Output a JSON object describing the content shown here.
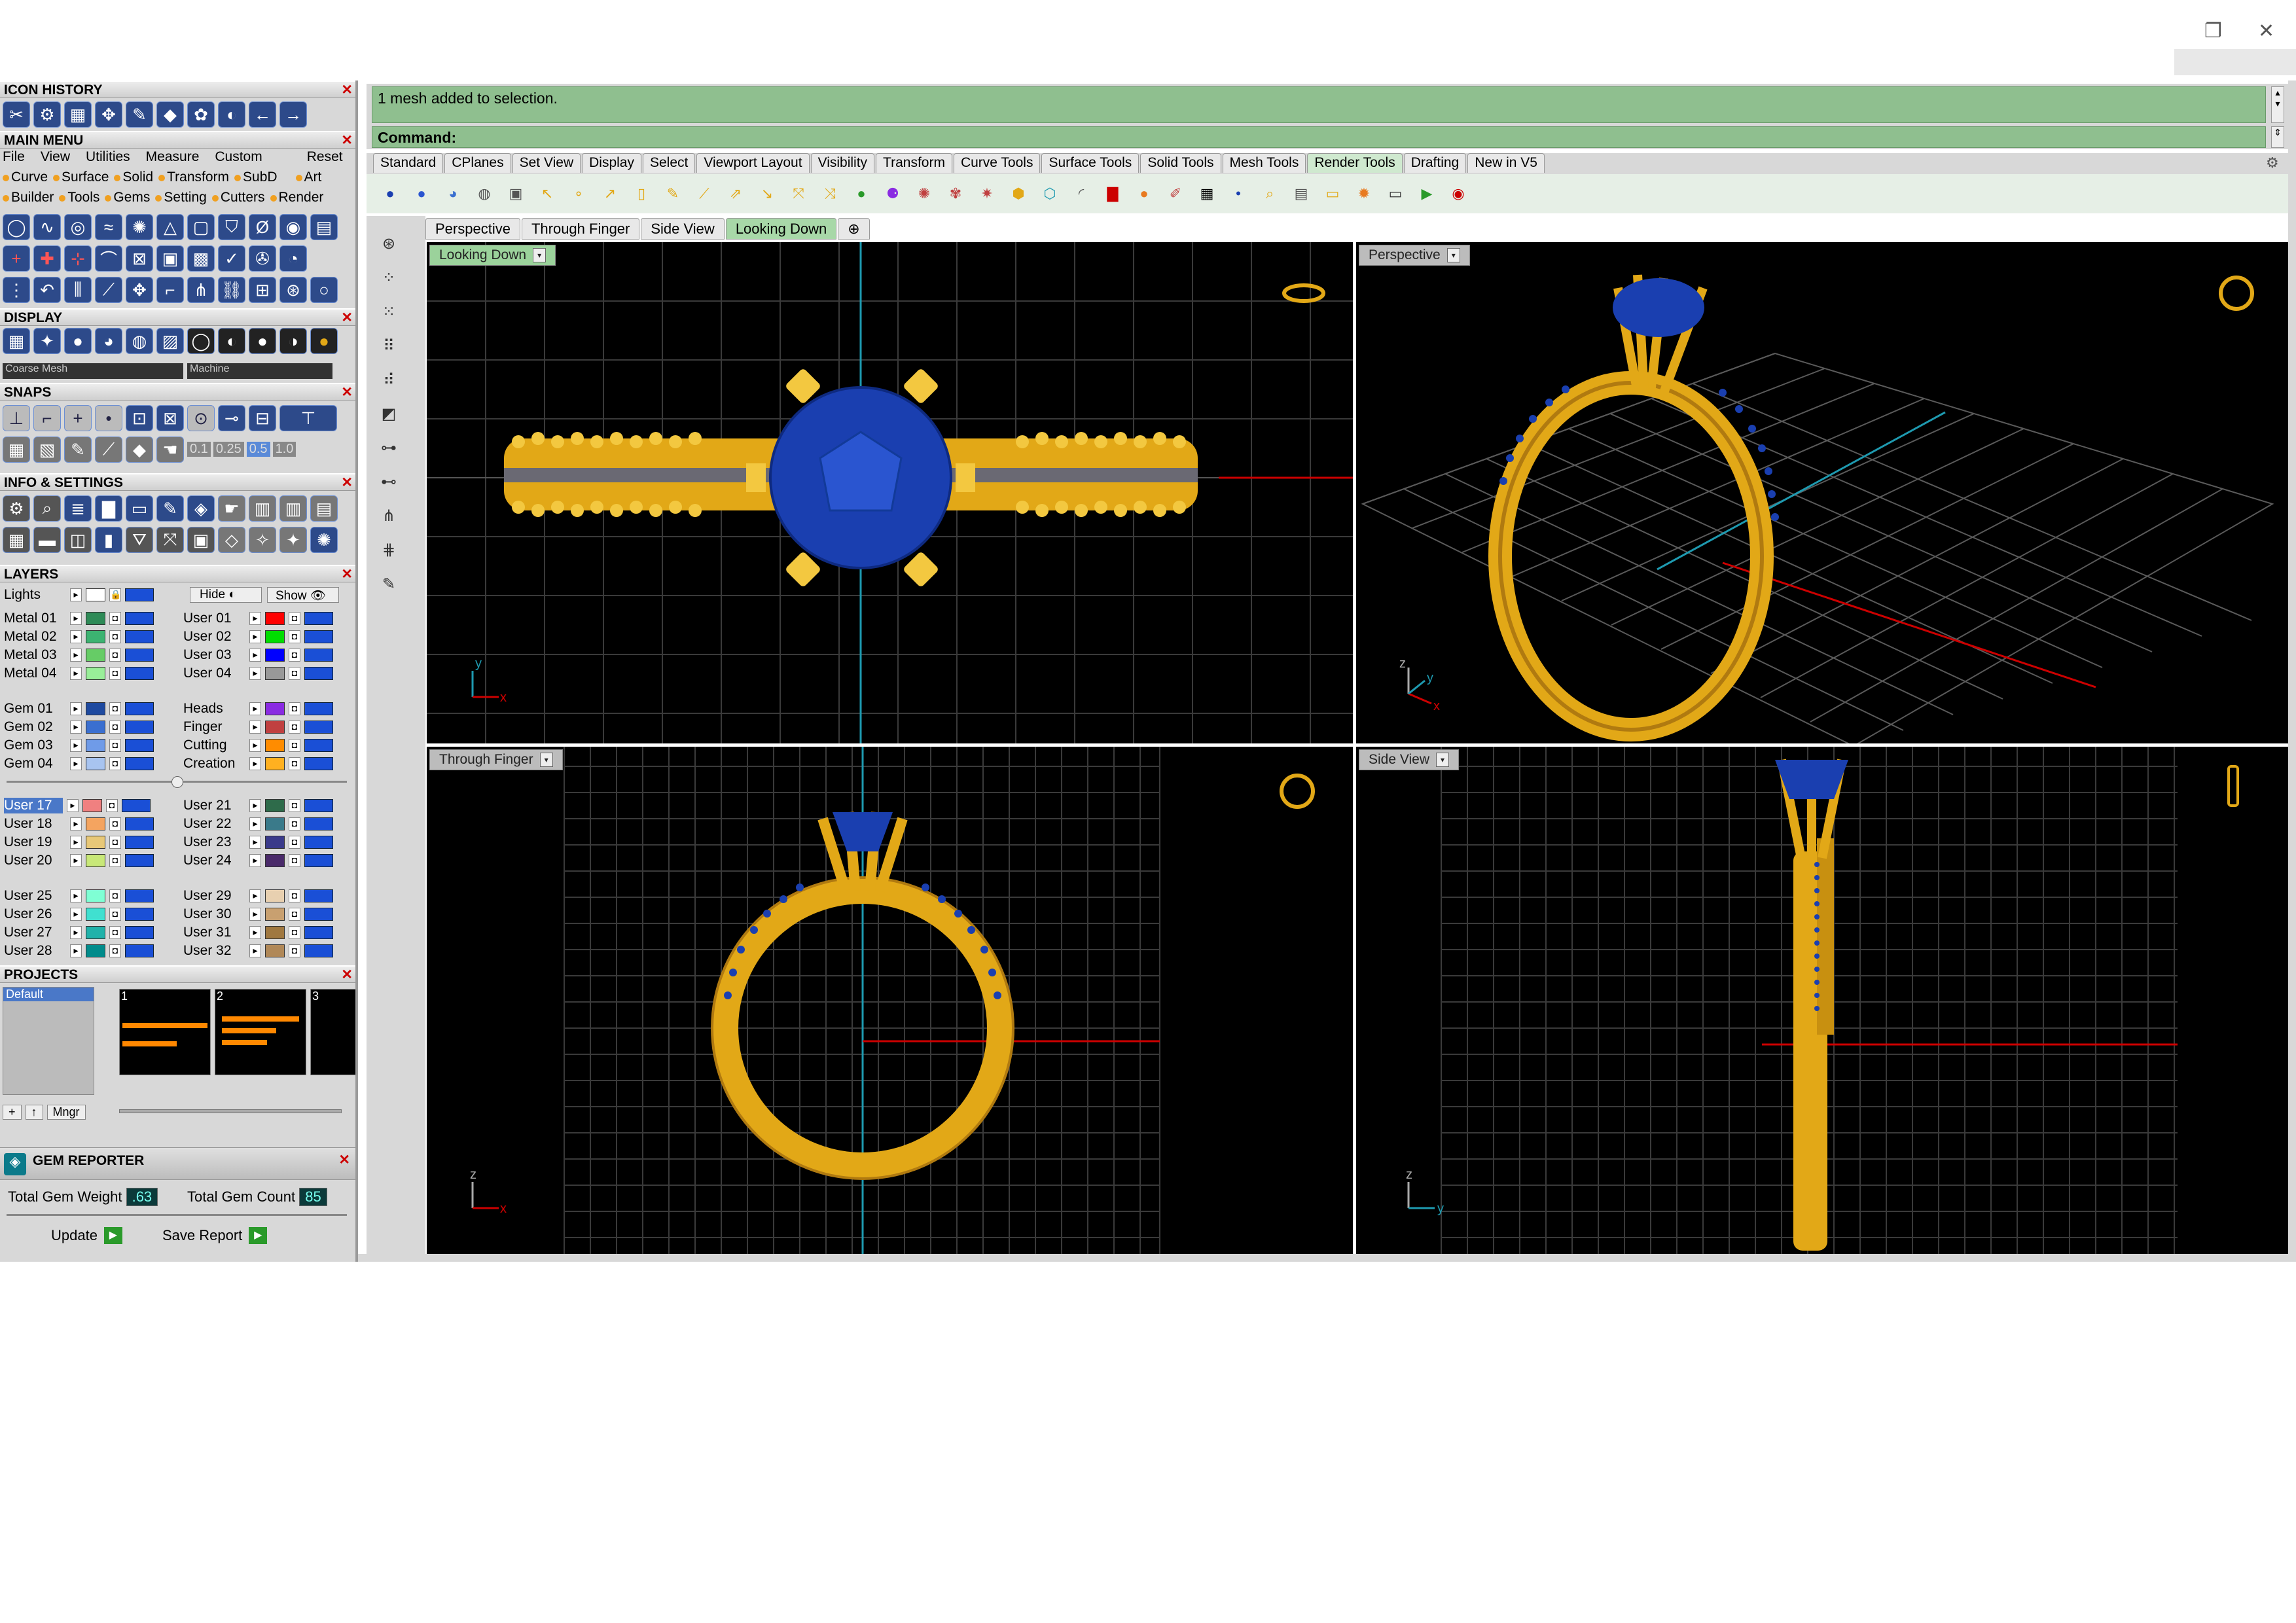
{
  "window": {
    "restore_glyph": "❐",
    "close_glyph": "✕"
  },
  "icon_history": {
    "title": "ICON HISTORY",
    "close": "✕"
  },
  "main_menu": {
    "title": "MAIN MENU",
    "close": "✕",
    "menu_items": [
      "File",
      "View",
      "Utilities",
      "Measure",
      "Custom",
      "Reset"
    ],
    "row1": [
      "Curve",
      "Surface",
      "Solid",
      "Transform",
      "SubD",
      "Art"
    ],
    "row2": [
      "Builder",
      "Tools",
      "Gems",
      "Setting",
      "Cutters",
      "Render"
    ]
  },
  "display": {
    "title": "DISPLAY",
    "close": "✕",
    "mesh_select": "Coarse Mesh",
    "material_select": "Machine"
  },
  "snaps": {
    "title": "SNAPS",
    "close": "✕",
    "values": [
      "0.1",
      "0.25",
      "0.5",
      "1.0"
    ]
  },
  "info_settings": {
    "title": "INFO & SETTINGS",
    "close": "✕"
  },
  "layers": {
    "title": "LAYERS",
    "close": "✕",
    "lights": "Lights",
    "hide": "Hide",
    "show": "Show",
    "left": [
      {
        "name": "Metal 01",
        "color": "#2e8b57"
      },
      {
        "name": "Metal 02",
        "color": "#3cb371"
      },
      {
        "name": "Metal 03",
        "color": "#66cc66"
      },
      {
        "name": "Metal 04",
        "color": "#99ee99"
      },
      {
        "name": "Gem 01",
        "color": "#1e4aa0"
      },
      {
        "name": "Gem 02",
        "color": "#3a6fd0"
      },
      {
        "name": "Gem 03",
        "color": "#6f9be8"
      },
      {
        "name": "Gem 04",
        "color": "#a8c4f0"
      },
      {
        "name": "User 17",
        "color": "#f08080"
      },
      {
        "name": "User 18",
        "color": "#f4a460"
      },
      {
        "name": "User 19",
        "color": "#e8c878"
      },
      {
        "name": "User 20",
        "color": "#c8e878"
      },
      {
        "name": "User 25",
        "color": "#7fffd4"
      },
      {
        "name": "User 26",
        "color": "#40e0d0"
      },
      {
        "name": "User 27",
        "color": "#20b2aa"
      },
      {
        "name": "User 28",
        "color": "#008b8b"
      }
    ],
    "right": [
      {
        "name": "User 01",
        "color": "#ff0000"
      },
      {
        "name": "User 02",
        "color": "#00dd00"
      },
      {
        "name": "User 03",
        "color": "#0000ff"
      },
      {
        "name": "User 04",
        "color": "#999999"
      },
      {
        "name": "Heads",
        "color": "#8a2be2"
      },
      {
        "name": "Finger",
        "color": "#c04040"
      },
      {
        "name": "Cutting",
        "color": "#ff8c00"
      },
      {
        "name": "Creation",
        "color": "#ffb020"
      },
      {
        "name": "User 21",
        "color": "#2e6b4a"
      },
      {
        "name": "User 22",
        "color": "#3a7a8a"
      },
      {
        "name": "User 23",
        "color": "#3a3a8a"
      },
      {
        "name": "User 24",
        "color": "#4a2a6a"
      },
      {
        "name": "User 29",
        "color": "#e8d0b0"
      },
      {
        "name": "User 30",
        "color": "#c8a070"
      },
      {
        "name": "User 31",
        "color": "#a07840"
      },
      {
        "name": "User 32",
        "color": "#b08858"
      }
    ]
  },
  "projects": {
    "title": "PROJECTS",
    "close": "✕",
    "default": "Default",
    "thumbs": [
      "1",
      "2",
      "3"
    ],
    "mngr": "Mngr"
  },
  "gem_reporter": {
    "title": "GEM REPORTER",
    "close": "✕",
    "weight_label": "Total Gem Weight",
    "weight": ".63",
    "count_label": "Total Gem Count",
    "count": "85",
    "update": "Update",
    "save": "Save Report"
  },
  "command": {
    "history": "1 mesh added to selection.",
    "prompt": "Command:"
  },
  "toolbar_tabs": [
    "Standard",
    "CPlanes",
    "Set View",
    "Display",
    "Select",
    "Viewport Layout",
    "Visibility",
    "Transform",
    "Curve Tools",
    "Surface Tools",
    "Solid Tools",
    "Mesh Tools",
    "Render Tools",
    "Drafting",
    "New in V5"
  ],
  "viewport_tabs": [
    "Perspective",
    "Through Finger",
    "Side View",
    "Looking Down"
  ],
  "viewports": {
    "top_left": "Looking Down",
    "top_right": "Perspective",
    "bottom_left": "Through Finger",
    "bottom_right": "Side View"
  },
  "axis_labels": {
    "x": "x",
    "y": "y",
    "z": "z"
  },
  "colors": {
    "gold": "#e2a817",
    "gem": "#1a3fb0",
    "accent_green": "#9bd29b"
  }
}
